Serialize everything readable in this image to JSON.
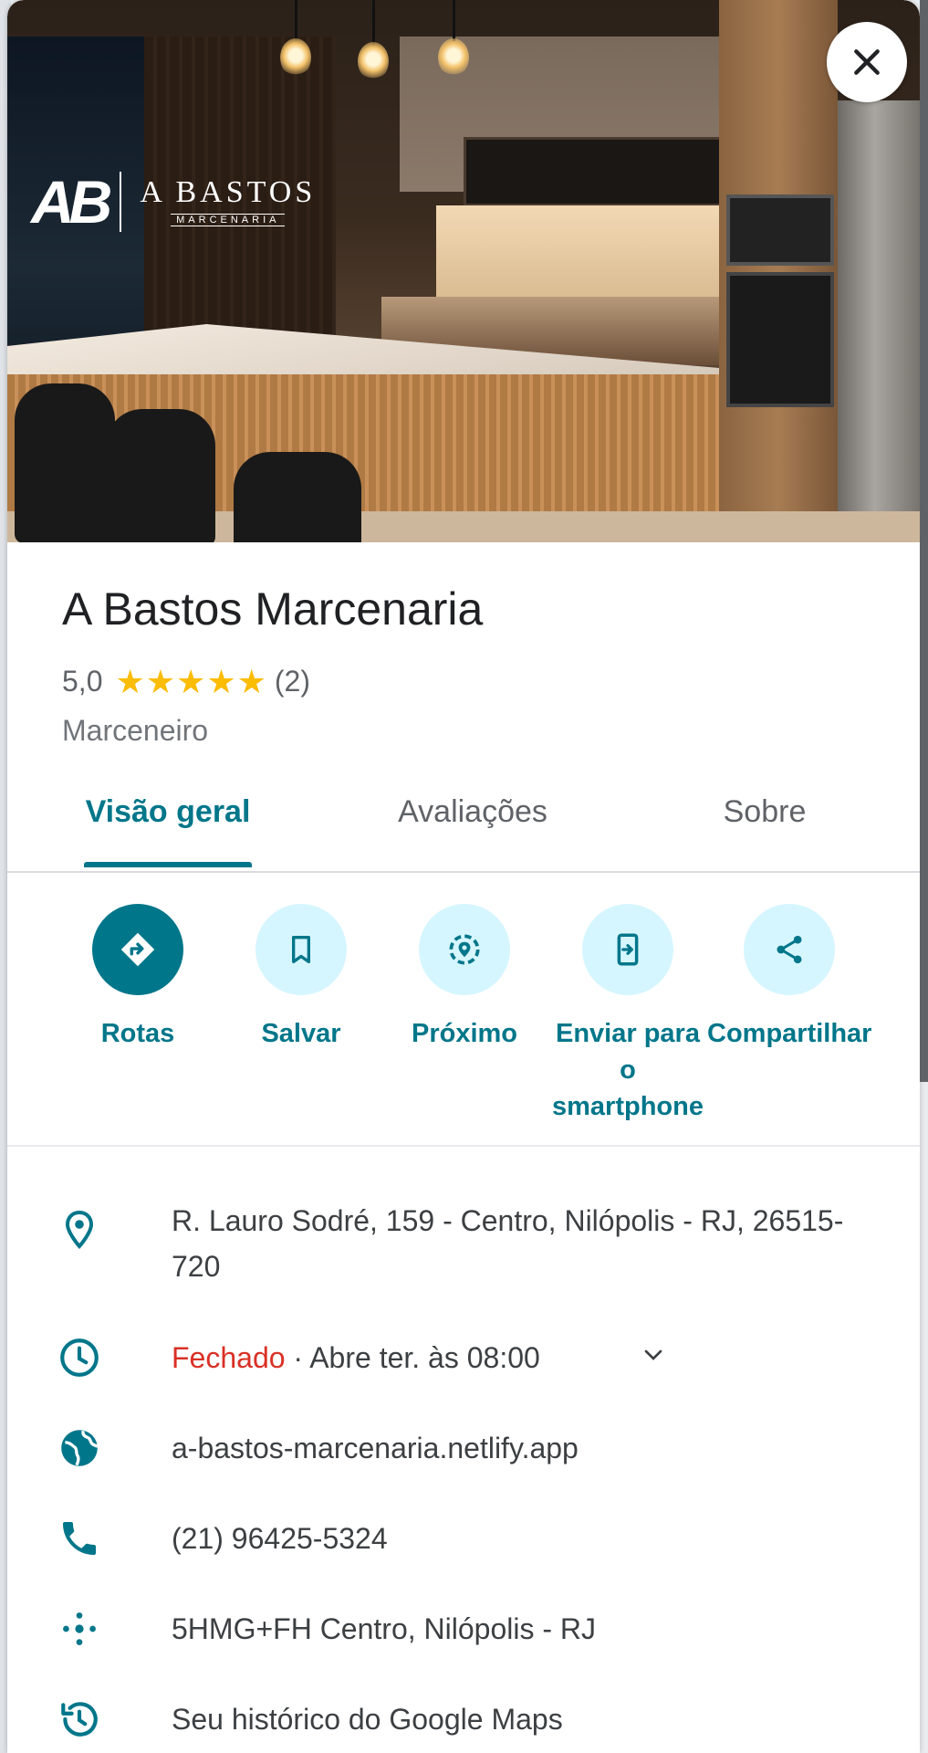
{
  "logo": {
    "mark": "AB",
    "name": "A BASTOS",
    "sub": "MARCENARIA"
  },
  "place": {
    "name": "A Bastos Marcenaria",
    "rating": "5,0",
    "rating_value": 5,
    "review_count": "(2)",
    "category": "Marceneiro"
  },
  "tabs": [
    {
      "label": "Visão geral",
      "active": true
    },
    {
      "label": "Avaliações",
      "active": false
    },
    {
      "label": "Sobre",
      "active": false
    }
  ],
  "actions": [
    {
      "label": "Rotas",
      "icon": "directions-icon"
    },
    {
      "label": "Salvar",
      "icon": "bookmark-icon"
    },
    {
      "label": "Próximo",
      "icon": "nearby-icon"
    },
    {
      "label": "Enviar para o smartphone",
      "icon": "send-to-phone-icon"
    },
    {
      "label": "Compartilhar",
      "icon": "share-icon"
    }
  ],
  "info": {
    "address": "R. Lauro Sodré, 159 - Centro, Nilópolis - RJ, 26515-720",
    "hours_status": "Fechado",
    "hours_detail": " · Abre ter. às 08:00",
    "website": "a-bastos-marcenaria.netlify.app",
    "phone": "(21) 96425-5324",
    "plus_code": "5HMG+FH Centro, Nilópolis - RJ",
    "history": "Seu histórico do Google Maps"
  },
  "colors": {
    "accent": "#00768a",
    "action_bg": "#d6f6ff",
    "star": "#fbbc04",
    "closed": "#d93025"
  }
}
